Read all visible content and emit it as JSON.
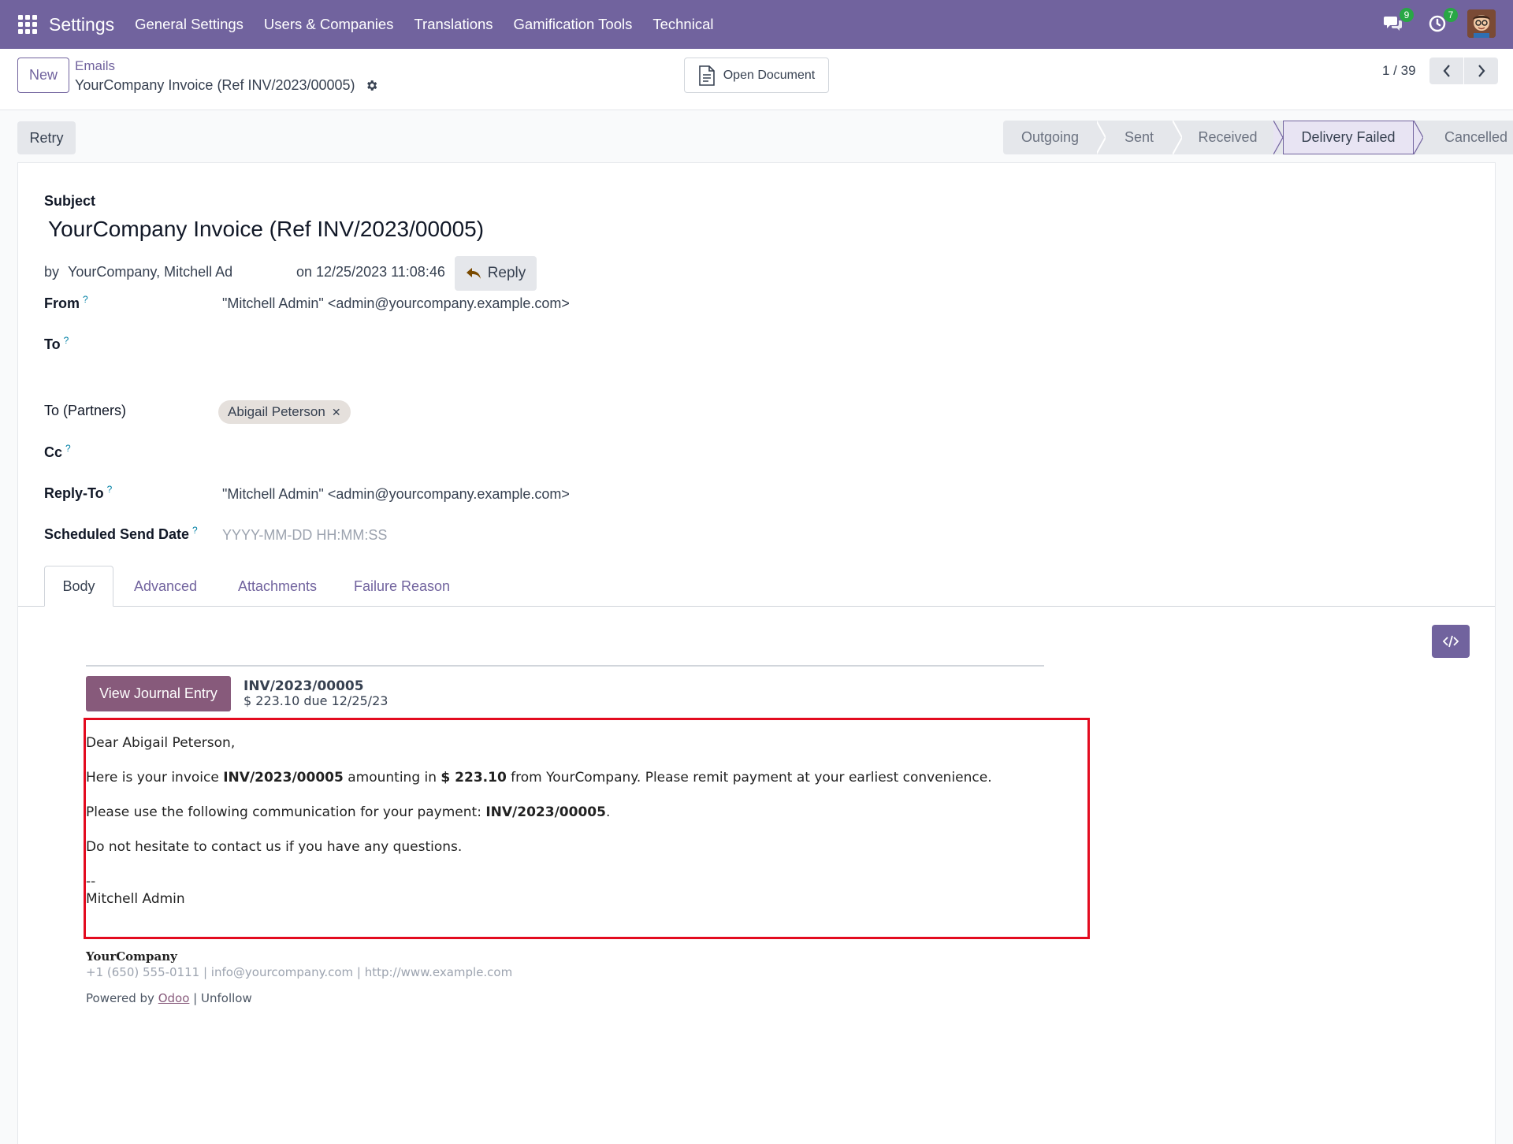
{
  "navbar": {
    "app_name": "Settings",
    "menu": [
      "General Settings",
      "Users & Companies",
      "Translations",
      "Gamification Tools",
      "Technical"
    ],
    "messages_badge": "9",
    "activities_badge": "7",
    "color": "#71639e"
  },
  "control": {
    "new_label": "New",
    "breadcrumb_parent": "Emails",
    "breadcrumb_current": "YourCompany Invoice (Ref INV/2023/00005)",
    "open_document_label": "Open Document",
    "pager": "1 / 39"
  },
  "status": {
    "retry_label": "Retry",
    "stages": [
      "Outgoing",
      "Sent",
      "Received",
      "Delivery Failed",
      "Cancelled"
    ],
    "active_stage": "Delivery Failed"
  },
  "form": {
    "subject_label": "Subject",
    "subject": "YourCompany Invoice (Ref INV/2023/00005)",
    "by_prefix": "by",
    "by": "YourCompany, Mitchell Ad",
    "on": "on 12/25/2023 11:08:46",
    "reply_label": "Reply",
    "from_label": "From",
    "from": "\"Mitchell Admin\" <admin@yourcompany.example.com>",
    "to_label": "To",
    "to_partners_label": "To (Partners)",
    "to_partner_tag": "Abigail Peterson",
    "cc_label": "Cc",
    "reply_to_label": "Reply-To",
    "reply_to": "\"Mitchell Admin\" <admin@yourcompany.example.com>",
    "scheduled_label": "Scheduled Send Date",
    "scheduled_placeholder": "YYYY-MM-DD HH:MM:SS",
    "help_mark": "?"
  },
  "tabs": [
    "Body",
    "Advanced",
    "Attachments",
    "Failure Reason"
  ],
  "active_tab": "Body",
  "body": {
    "view_journal_label": "View Journal Entry",
    "invoice_ref": "INV/2023/00005",
    "amount_due": "$ 223.10 due 12/25/23",
    "greeting": "Dear Abigail Peterson,",
    "line1_a": "Here is your invoice ",
    "line1_ref": "INV/2023/00005",
    "line1_b": " amounting in ",
    "line1_amount": "$ 223.10",
    "line1_c": " from YourCompany. Please remit payment at your earliest convenience.",
    "line2_a": "Please use the following communication for your payment: ",
    "line2_ref": "INV/2023/00005",
    "line2_b": ".",
    "line3": "Do not hesitate to contact us if you have any questions.",
    "sig_dash": "--",
    "sig_name": "Mitchell Admin",
    "company": "YourCompany",
    "contact": "+1 (650) 555-0111 | info@yourcompany.com | http://www.example.com",
    "powered_prefix": "Powered by ",
    "powered_link": "Odoo",
    "powered_sep": " | ",
    "unfollow": "Unfollow"
  }
}
